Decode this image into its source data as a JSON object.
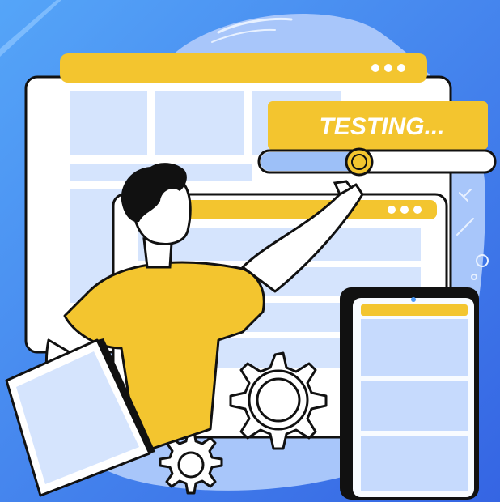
{
  "scene": {
    "testing_label": "TESTING...",
    "window_controls": [
      "dot",
      "dot",
      "dot"
    ],
    "progress_fraction": 0.32
  },
  "colors": {
    "background_start": "#4d9af7",
    "background_end": "#3a6fe6",
    "blob": "#a9c8fb",
    "blob_light": "#c6dafd",
    "yellow": "#f3c52f",
    "panel": "#d5e4fd",
    "white": "#ffffff",
    "outline": "#111111"
  },
  "icons": [
    "cursor-circle-icon",
    "gear-icon",
    "sparkle-icon",
    "ring-icon"
  ]
}
